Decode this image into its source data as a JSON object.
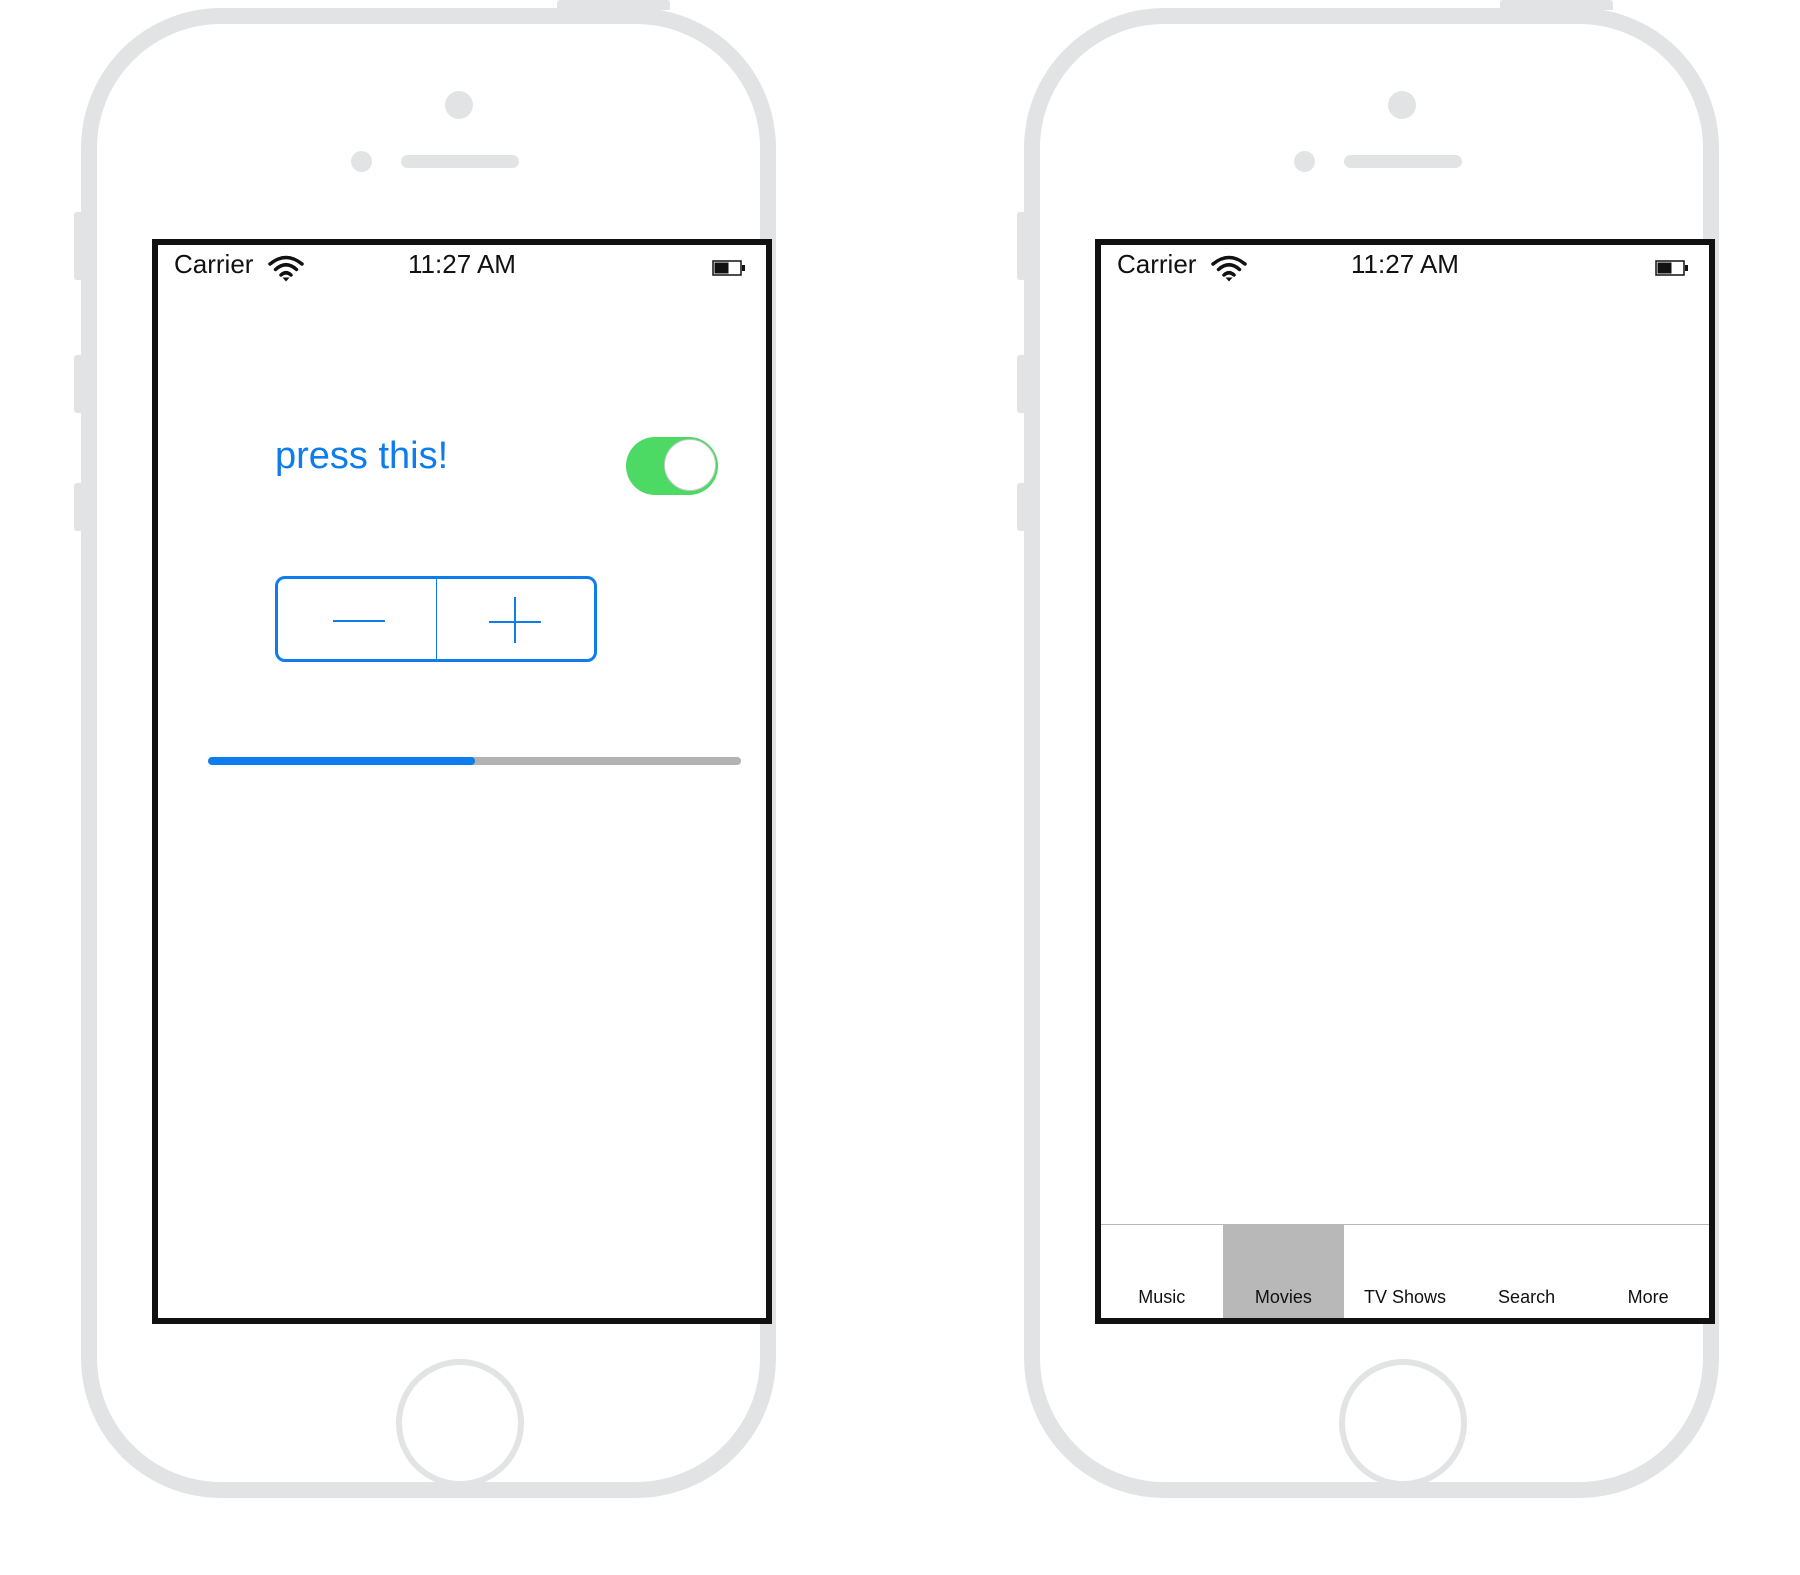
{
  "status_bar": {
    "carrier": "Carrier",
    "time": "11:27 AM",
    "wifi_icon": "wifi-icon",
    "battery_icon": "battery-icon"
  },
  "left_screen": {
    "label": "press this!",
    "toggle_on": true,
    "stepper": {
      "minus_icon": "minus-icon",
      "plus_icon": "plus-icon"
    },
    "progress": 0.5
  },
  "right_screen": {
    "tabs": [
      {
        "label": "Music",
        "selected": false
      },
      {
        "label": "Movies",
        "selected": true
      },
      {
        "label": "TV Shows",
        "selected": false
      },
      {
        "label": "Search",
        "selected": false
      },
      {
        "label": "More",
        "selected": false
      }
    ]
  },
  "colors": {
    "accent": "#0d7dee",
    "toggle_on": "#4cd964",
    "phone_frame": "#e2e3e5",
    "progress_track": "#b3b3b3",
    "tab_selected": "#b8b8b8"
  }
}
